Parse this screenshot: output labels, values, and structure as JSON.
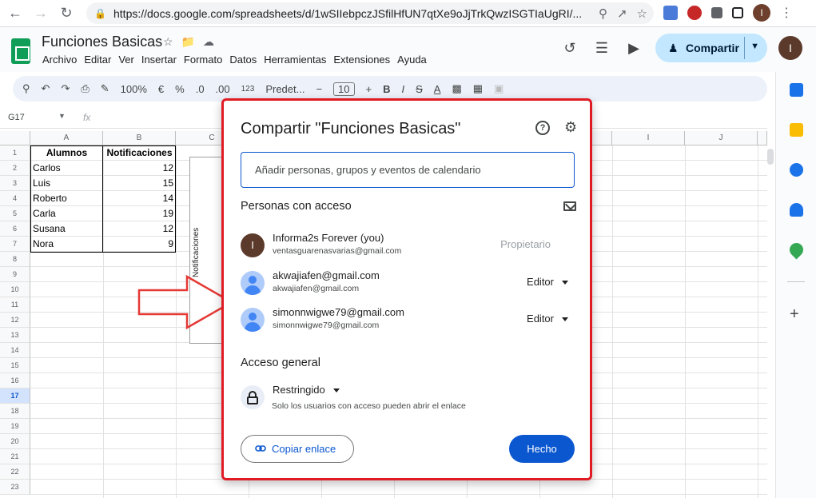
{
  "browser": {
    "url": "https://docs.google.com/spreadsheets/d/1wSIIebpczJSfilHfUN7qtXe9oJjTrkQwzISGTIaUgRI/...",
    "profile_initial": "I"
  },
  "sheets": {
    "title": "Funciones Basicas",
    "menu": [
      "Archivo",
      "Editar",
      "Ver",
      "Insertar",
      "Formato",
      "Datos",
      "Herramientas",
      "Extensiones",
      "Ayuda"
    ],
    "share_label": "Compartir",
    "profile_initial": "I",
    "toolbar": {
      "zoom": "100%",
      "currency": "€",
      "percent": "%",
      "decimal_less": ".0",
      "decimal_more": ".00",
      "number_format": "123",
      "font": "Predet...",
      "font_size": "10"
    },
    "namebox": "G17",
    "fx": "fx"
  },
  "grid": {
    "columns": [
      "A",
      "B",
      "C",
      "I",
      "J"
    ],
    "rows": [
      "1",
      "2",
      "3",
      "4",
      "5",
      "6",
      "7",
      "8",
      "9",
      "10",
      "11",
      "12",
      "13",
      "14",
      "15",
      "16",
      "17",
      "18",
      "19",
      "20",
      "21",
      "22",
      "23"
    ],
    "selected_row": "17",
    "table_headers": [
      "Alumnos",
      "Notificaciones"
    ],
    "table_rows": [
      {
        "name": "Carlos",
        "value": "12"
      },
      {
        "name": "Luis",
        "value": "15"
      },
      {
        "name": "Roberto",
        "value": "14"
      },
      {
        "name": "Carla",
        "value": "19"
      },
      {
        "name": "Susana",
        "value": "12"
      },
      {
        "name": "Nora",
        "value": "9"
      }
    ],
    "chart_label": "Notificaciones"
  },
  "dialog": {
    "title": "Compartir \"Funciones Basicas\"",
    "help_glyph": "?",
    "gear_glyph": "⚙",
    "add_placeholder": "Añadir personas, grupos y eventos de calendario",
    "people_heading": "Personas con acceso",
    "people": [
      {
        "name": "Informa2s Forever (you)",
        "email": "ventasguarenasvarias@gmail.com",
        "role": "Propietario",
        "initial": "I"
      },
      {
        "name": "akwajiafen@gmail.com",
        "email": "akwajiafen@gmail.com",
        "role": "Editor"
      },
      {
        "name": "simonnwigwe79@gmail.com",
        "email": "simonnwigwe79@gmail.com",
        "role": "Editor"
      }
    ],
    "general_heading": "Acceso general",
    "access_level": "Restringido",
    "access_desc": "Solo los usuarios con acceso pueden abrir el enlace",
    "copy_link": "Copiar enlace",
    "done": "Hecho"
  }
}
